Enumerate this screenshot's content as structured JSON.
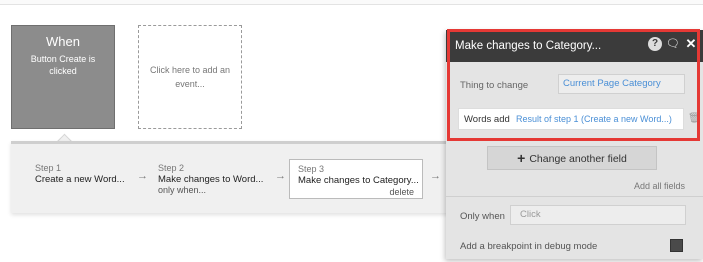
{
  "event": {
    "title": "When",
    "description": "Button Create is clicked"
  },
  "add_event": {
    "label": "Click here to add an event..."
  },
  "steps": [
    {
      "number": "Step 1",
      "name": "Create a new Word...",
      "sub": ""
    },
    {
      "number": "Step 2",
      "name": "Make changes to Word...",
      "sub": "only when..."
    },
    {
      "number": "Step 3",
      "name": "Make changes to Category...",
      "sub": "",
      "action": "delete"
    }
  ],
  "panel": {
    "title": "Make changes to Category...",
    "thing_to_change_label": "Thing to change",
    "thing_to_change_value": "Current Page Category",
    "field_label": "Words add",
    "field_value": "Result of step 1 (Create a new Word...)",
    "change_button": "Change another field",
    "add_all": "Add all fields",
    "only_when_label": "Only when",
    "only_when_placeholder": "Click",
    "debug_label": "Add a breakpoint in debug mode"
  },
  "icons": {
    "help": "question-circle",
    "comment": "speech-bubble",
    "close": "close-x",
    "trash": "trash-can",
    "arrow": "arrow-right",
    "plus": "plus"
  },
  "colors": {
    "highlight": "#e53935",
    "panel_header": "#3b3b3b",
    "link_blue": "#4a8fd6",
    "event_card": "#8c8c8c"
  }
}
